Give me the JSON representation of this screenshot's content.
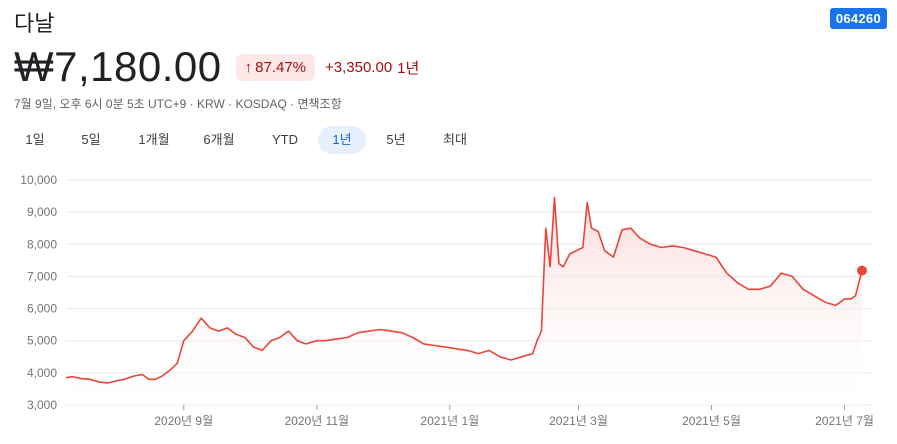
{
  "header": {
    "company_name": "다날",
    "ticker": "064260",
    "price": "₩7,180.00",
    "change_percent": "87.47%",
    "change_arrow_icon": "arrow-up-icon",
    "change_amount": "+3,350.00",
    "change_period": "1년",
    "meta": "7월 9일, 오후 6시 0분 5초 UTC+9 · KRW · KOSDAQ · 면책조항"
  },
  "range_tabs": [
    {
      "label": "1일",
      "active": false
    },
    {
      "label": "5일",
      "active": false
    },
    {
      "label": "1개월",
      "active": false
    },
    {
      "label": "6개월",
      "active": false
    },
    {
      "label": "YTD",
      "active": false
    },
    {
      "label": "1년",
      "active": true
    },
    {
      "label": "5년",
      "active": false
    },
    {
      "label": "최대",
      "active": false
    }
  ],
  "colors": {
    "line": "#e8453c",
    "fill_top": "#f8d7d5",
    "grid": "#e8eaed",
    "axis_text": "#70757a"
  },
  "chart_data": {
    "type": "area",
    "title": "",
    "xlabel": "",
    "ylabel": "",
    "ylim": [
      3000,
      10000
    ],
    "y_ticks": [
      "10,000",
      "9,000",
      "8,000",
      "7,000",
      "6,000",
      "5,000",
      "4,000",
      "3,000"
    ],
    "y_tick_values": [
      10000,
      9000,
      8000,
      7000,
      6000,
      5000,
      4000,
      3000
    ],
    "xlim": [
      "2020-07-09",
      "2021-07-09"
    ],
    "x_ticks": [
      {
        "label": "2020년 9월",
        "date": "2020-09-01"
      },
      {
        "label": "2020년 11월",
        "date": "2020-11-01"
      },
      {
        "label": "2021년 1월",
        "date": "2021-01-01"
      },
      {
        "label": "2021년 3월",
        "date": "2021-03-01"
      },
      {
        "label": "2021년 5월",
        "date": "2021-05-01"
      },
      {
        "label": "2021년 7월",
        "date": "2021-07-01"
      }
    ],
    "grid": true,
    "last_point_marker": true,
    "series": [
      {
        "x": [
          "2020-07-09",
          "2020-07-12",
          "2020-07-16",
          "2020-07-20",
          "2020-07-24",
          "2020-07-28",
          "2020-08-01",
          "2020-08-05",
          "2020-08-09",
          "2020-08-13",
          "2020-08-16",
          "2020-08-19",
          "2020-08-22",
          "2020-08-26",
          "2020-08-29",
          "2020-09-01",
          "2020-09-05",
          "2020-09-09",
          "2020-09-13",
          "2020-09-17",
          "2020-09-21",
          "2020-09-25",
          "2020-09-29",
          "2020-10-03",
          "2020-10-07",
          "2020-10-11",
          "2020-10-15",
          "2020-10-19",
          "2020-10-23",
          "2020-10-27",
          "2020-11-01",
          "2020-11-05",
          "2020-11-10",
          "2020-11-15",
          "2020-11-20",
          "2020-11-25",
          "2020-11-30",
          "2020-12-05",
          "2020-12-10",
          "2020-12-15",
          "2020-12-20",
          "2020-12-25",
          "2020-12-30",
          "2021-01-04",
          "2021-01-09",
          "2021-01-14",
          "2021-01-19",
          "2021-01-24",
          "2021-01-29",
          "2021-02-03",
          "2021-02-08",
          "2021-02-10",
          "2021-02-12",
          "2021-02-14",
          "2021-02-16",
          "2021-02-18",
          "2021-02-20",
          "2021-02-22",
          "2021-02-25",
          "2021-02-28",
          "2021-03-03",
          "2021-03-05",
          "2021-03-07",
          "2021-03-10",
          "2021-03-13",
          "2021-03-17",
          "2021-03-21",
          "2021-03-25",
          "2021-03-29",
          "2021-04-03",
          "2021-04-08",
          "2021-04-13",
          "2021-04-18",
          "2021-04-23",
          "2021-04-28",
          "2021-05-03",
          "2021-05-08",
          "2021-05-13",
          "2021-05-18",
          "2021-05-23",
          "2021-05-28",
          "2021-06-02",
          "2021-06-07",
          "2021-06-12",
          "2021-06-17",
          "2021-06-22",
          "2021-06-27",
          "2021-07-01",
          "2021-07-04",
          "2021-07-06",
          "2021-07-09"
        ],
        "values": [
          3850,
          3880,
          3820,
          3800,
          3720,
          3680,
          3750,
          3800,
          3900,
          3950,
          3800,
          3800,
          3900,
          4100,
          4300,
          5000,
          5300,
          5700,
          5400,
          5300,
          5400,
          5200,
          5100,
          4800,
          4700,
          5000,
          5100,
          5300,
          5000,
          4900,
          5000,
          5000,
          5050,
          5100,
          5250,
          5300,
          5350,
          5300,
          5250,
          5100,
          4900,
          4850,
          4800,
          4750,
          4700,
          4600,
          4700,
          4500,
          4400,
          4500,
          4600,
          5000,
          5300,
          8500,
          7300,
          9450,
          7400,
          7300,
          7700,
          7800,
          7900,
          9300,
          8500,
          8400,
          7800,
          7600,
          8450,
          8500,
          8200,
          8000,
          7900,
          7950,
          7900,
          7800,
          7700,
          7600,
          7100,
          6800,
          6600,
          6600,
          6700,
          7100,
          7000,
          6600,
          6400,
          6200,
          6100,
          6300,
          6300,
          6400,
          7180
        ]
      }
    ]
  }
}
